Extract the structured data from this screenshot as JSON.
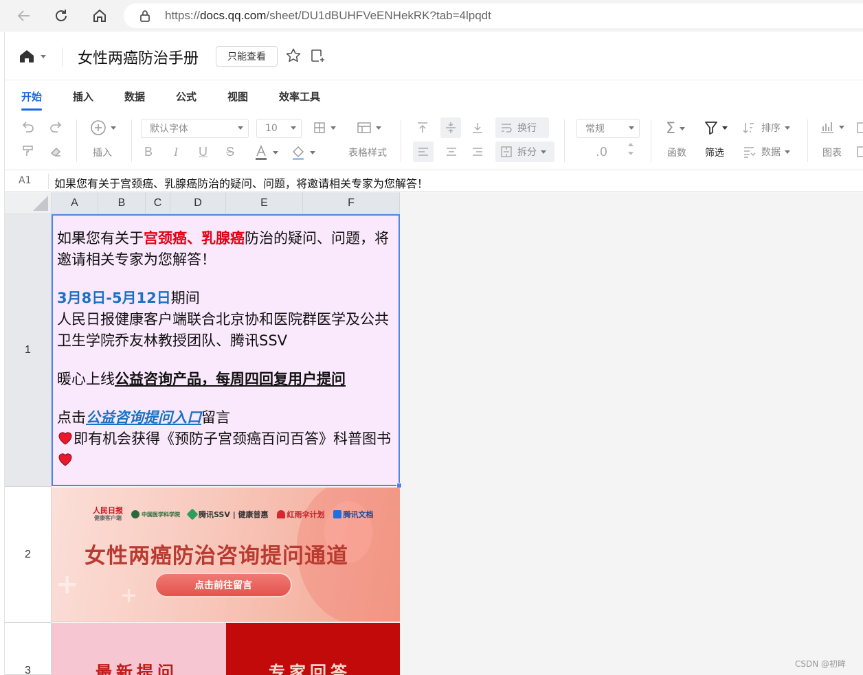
{
  "browser": {
    "url_prefix": "https://",
    "url_host": "docs.qq.com",
    "url_path": "/sheet/DU1dBUHFVeENHekRK?tab=4lpqdt"
  },
  "header": {
    "doc_title": "女性两癌防治手册",
    "readonly_badge": "只能查看"
  },
  "menu": {
    "tabs": [
      "开始",
      "插入",
      "数据",
      "公式",
      "视图",
      "效率工具"
    ],
    "active": "开始"
  },
  "toolbar": {
    "insert_label": "插入",
    "font_family": "默认字体",
    "font_size": "10",
    "table_style_label": "表格样式",
    "wrap_label": "换行",
    "split_label": "拆分",
    "number_format": "常规",
    "decimal_label": ".0",
    "function_label": "函数",
    "filter_label": "筛选",
    "sort_label": "排序",
    "data_label": "数据",
    "chart_label": "图表"
  },
  "formula_bar": {
    "cell_ref": "A1",
    "content": "如果您有关于宫颈癌、乳腺癌防治的疑问、问题，将邀请相关专家为您解答！"
  },
  "grid": {
    "columns": [
      "A",
      "B",
      "C",
      "D",
      "E",
      "F"
    ],
    "rows": [
      "1",
      "2",
      "3"
    ]
  },
  "cell_a1": {
    "line1_pre": "如果您有关于",
    "line1_red": "宫颈癌、乳腺癌",
    "line1_post": "防治的疑问、问题，将邀请相关专家为您解答！",
    "date_blue": "3月8日-5月12日",
    "date_post": "期间",
    "org_text": "人民日报健康客户端联合北京协和医院群医学及公共卫生学院乔友林教授团队、腾讯SSV",
    "service_pre": "暖心上线",
    "service_bold": "公益咨询产品，每周四回复用户提问",
    "click_pre": "点击",
    "click_link": "公益咨询提问入口",
    "click_post": "留言",
    "reward_text": "即有机会获得《预防子宫颈癌百问百答》科普图书"
  },
  "banner": {
    "logo_1": "人民日报",
    "logo_1_sub": "健康客户端",
    "logo_2": "中国医学科学院",
    "logo_3": "腾讯SSV | 健康普惠",
    "logo_4": "红雨伞计划",
    "logo_5": "腾讯文档",
    "title": "女性两癌防治咨询提问通道",
    "button": "点击前往留言"
  },
  "row3": {
    "left_label": "最新提问",
    "right_label": "专家回答"
  },
  "colors": {
    "accent": "#1a66e8",
    "highlight_red": "#e60012",
    "highlight_blue": "#1b72c4",
    "cell_bg": "#fae8fc"
  },
  "watermark": "CSDN @初眸"
}
